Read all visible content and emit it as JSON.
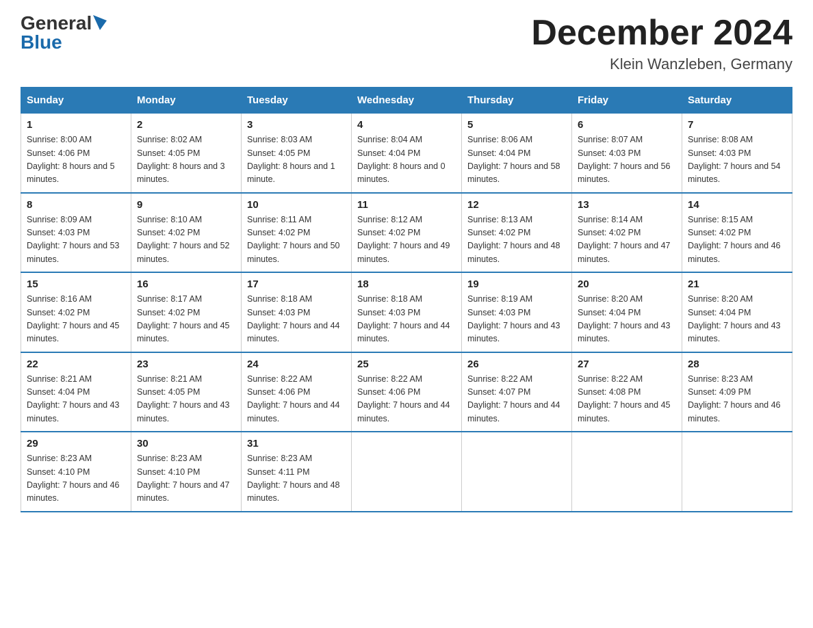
{
  "logo": {
    "general": "General",
    "blue": "Blue"
  },
  "header": {
    "month_title": "December 2024",
    "location": "Klein Wanzleben, Germany"
  },
  "days_of_week": [
    "Sunday",
    "Monday",
    "Tuesday",
    "Wednesday",
    "Thursday",
    "Friday",
    "Saturday"
  ],
  "weeks": [
    [
      {
        "day": "1",
        "sunrise": "8:00 AM",
        "sunset": "4:06 PM",
        "daylight": "8 hours and 5 minutes."
      },
      {
        "day": "2",
        "sunrise": "8:02 AM",
        "sunset": "4:05 PM",
        "daylight": "8 hours and 3 minutes."
      },
      {
        "day": "3",
        "sunrise": "8:03 AM",
        "sunset": "4:05 PM",
        "daylight": "8 hours and 1 minute."
      },
      {
        "day": "4",
        "sunrise": "8:04 AM",
        "sunset": "4:04 PM",
        "daylight": "8 hours and 0 minutes."
      },
      {
        "day": "5",
        "sunrise": "8:06 AM",
        "sunset": "4:04 PM",
        "daylight": "7 hours and 58 minutes."
      },
      {
        "day": "6",
        "sunrise": "8:07 AM",
        "sunset": "4:03 PM",
        "daylight": "7 hours and 56 minutes."
      },
      {
        "day": "7",
        "sunrise": "8:08 AM",
        "sunset": "4:03 PM",
        "daylight": "7 hours and 54 minutes."
      }
    ],
    [
      {
        "day": "8",
        "sunrise": "8:09 AM",
        "sunset": "4:03 PM",
        "daylight": "7 hours and 53 minutes."
      },
      {
        "day": "9",
        "sunrise": "8:10 AM",
        "sunset": "4:02 PM",
        "daylight": "7 hours and 52 minutes."
      },
      {
        "day": "10",
        "sunrise": "8:11 AM",
        "sunset": "4:02 PM",
        "daylight": "7 hours and 50 minutes."
      },
      {
        "day": "11",
        "sunrise": "8:12 AM",
        "sunset": "4:02 PM",
        "daylight": "7 hours and 49 minutes."
      },
      {
        "day": "12",
        "sunrise": "8:13 AM",
        "sunset": "4:02 PM",
        "daylight": "7 hours and 48 minutes."
      },
      {
        "day": "13",
        "sunrise": "8:14 AM",
        "sunset": "4:02 PM",
        "daylight": "7 hours and 47 minutes."
      },
      {
        "day": "14",
        "sunrise": "8:15 AM",
        "sunset": "4:02 PM",
        "daylight": "7 hours and 46 minutes."
      }
    ],
    [
      {
        "day": "15",
        "sunrise": "8:16 AM",
        "sunset": "4:02 PM",
        "daylight": "7 hours and 45 minutes."
      },
      {
        "day": "16",
        "sunrise": "8:17 AM",
        "sunset": "4:02 PM",
        "daylight": "7 hours and 45 minutes."
      },
      {
        "day": "17",
        "sunrise": "8:18 AM",
        "sunset": "4:03 PM",
        "daylight": "7 hours and 44 minutes."
      },
      {
        "day": "18",
        "sunrise": "8:18 AM",
        "sunset": "4:03 PM",
        "daylight": "7 hours and 44 minutes."
      },
      {
        "day": "19",
        "sunrise": "8:19 AM",
        "sunset": "4:03 PM",
        "daylight": "7 hours and 43 minutes."
      },
      {
        "day": "20",
        "sunrise": "8:20 AM",
        "sunset": "4:04 PM",
        "daylight": "7 hours and 43 minutes."
      },
      {
        "day": "21",
        "sunrise": "8:20 AM",
        "sunset": "4:04 PM",
        "daylight": "7 hours and 43 minutes."
      }
    ],
    [
      {
        "day": "22",
        "sunrise": "8:21 AM",
        "sunset": "4:04 PM",
        "daylight": "7 hours and 43 minutes."
      },
      {
        "day": "23",
        "sunrise": "8:21 AM",
        "sunset": "4:05 PM",
        "daylight": "7 hours and 43 minutes."
      },
      {
        "day": "24",
        "sunrise": "8:22 AM",
        "sunset": "4:06 PM",
        "daylight": "7 hours and 44 minutes."
      },
      {
        "day": "25",
        "sunrise": "8:22 AM",
        "sunset": "4:06 PM",
        "daylight": "7 hours and 44 minutes."
      },
      {
        "day": "26",
        "sunrise": "8:22 AM",
        "sunset": "4:07 PM",
        "daylight": "7 hours and 44 minutes."
      },
      {
        "day": "27",
        "sunrise": "8:22 AM",
        "sunset": "4:08 PM",
        "daylight": "7 hours and 45 minutes."
      },
      {
        "day": "28",
        "sunrise": "8:23 AM",
        "sunset": "4:09 PM",
        "daylight": "7 hours and 46 minutes."
      }
    ],
    [
      {
        "day": "29",
        "sunrise": "8:23 AM",
        "sunset": "4:10 PM",
        "daylight": "7 hours and 46 minutes."
      },
      {
        "day": "30",
        "sunrise": "8:23 AM",
        "sunset": "4:10 PM",
        "daylight": "7 hours and 47 minutes."
      },
      {
        "day": "31",
        "sunrise": "8:23 AM",
        "sunset": "4:11 PM",
        "daylight": "7 hours and 48 minutes."
      },
      null,
      null,
      null,
      null
    ]
  ]
}
